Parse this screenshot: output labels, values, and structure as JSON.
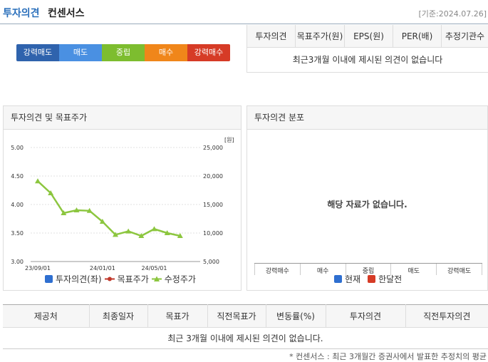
{
  "header": {
    "title_blue": "투자의견",
    "title_black": "컨센서스",
    "date": "[기준:2024.07.26]"
  },
  "opinion_bar": [
    {
      "label": "강력매도",
      "color": "#2f63ad"
    },
    {
      "label": "매도",
      "color": "#4a90e2"
    },
    {
      "label": "중립",
      "color": "#7dbd2f"
    },
    {
      "label": "매수",
      "color": "#f0861a"
    },
    {
      "label": "강력매수",
      "color": "#d63b26"
    }
  ],
  "consensus_table": {
    "headers": [
      "투자의견",
      "목표주가(원)",
      "EPS(원)",
      "PER(배)",
      "추정기관수"
    ],
    "empty_message": "최근3개월 이내에 제시된 의견이 없습니다"
  },
  "chart_panel": {
    "title": "투자의견 및 목표주가",
    "legend": [
      "투자의견(좌)",
      "목표주가",
      "수정주가"
    ]
  },
  "chart_data": {
    "type": "line",
    "x": [
      "23/09/01",
      "",
      "",
      "",
      "",
      "24/01/01",
      "",
      "",
      "",
      "24/05/01",
      "",
      "",
      ""
    ],
    "xtick_labels": [
      "23/09/01",
      "24/01/01",
      "24/05/01"
    ],
    "left_axis": {
      "ticks": [
        "5.00",
        "4.50",
        "4.00",
        "3.50",
        "3.00"
      ],
      "ylim": [
        3.0,
        5.0
      ]
    },
    "right_axis": {
      "unit": "[원]",
      "ticks": [
        "25,000",
        "20,000",
        "15,000",
        "10,000",
        "5,000"
      ],
      "ylim": [
        5000,
        25000
      ]
    },
    "series": [
      {
        "name": "수정주가",
        "color": "#8cc63f",
        "values": [
          19100,
          17000,
          13500,
          14000,
          13900,
          12000,
          9700,
          10300,
          9500,
          10700,
          10000,
          9500
        ]
      },
      {
        "name": "목표주가",
        "color": "#c0392b",
        "values": []
      },
      {
        "name": "투자의견(좌)",
        "color": "#2f6fd0",
        "values": []
      }
    ]
  },
  "distribution_panel": {
    "title": "투자의견 분포",
    "empty_message": "해당 자료가 없습니다.",
    "categories": [
      "강력매수",
      "매수",
      "중립",
      "매도",
      "강력매도"
    ],
    "legend": [
      {
        "label": "현재",
        "color": "#2f6fd0"
      },
      {
        "label": "한달전",
        "color": "#d63b26"
      }
    ]
  },
  "detail_table": {
    "headers": [
      "제공처",
      "최종일자",
      "목표가",
      "직전목표가",
      "변동률(%)",
      "투자의견",
      "직전투자의견"
    ],
    "empty_message": "최근 3개월 이내에 제시된 의견이 없습니다."
  },
  "footnote": "* 컨센서스 : 최근 3개월간 증권사에서 발표한 추정치의 평균"
}
